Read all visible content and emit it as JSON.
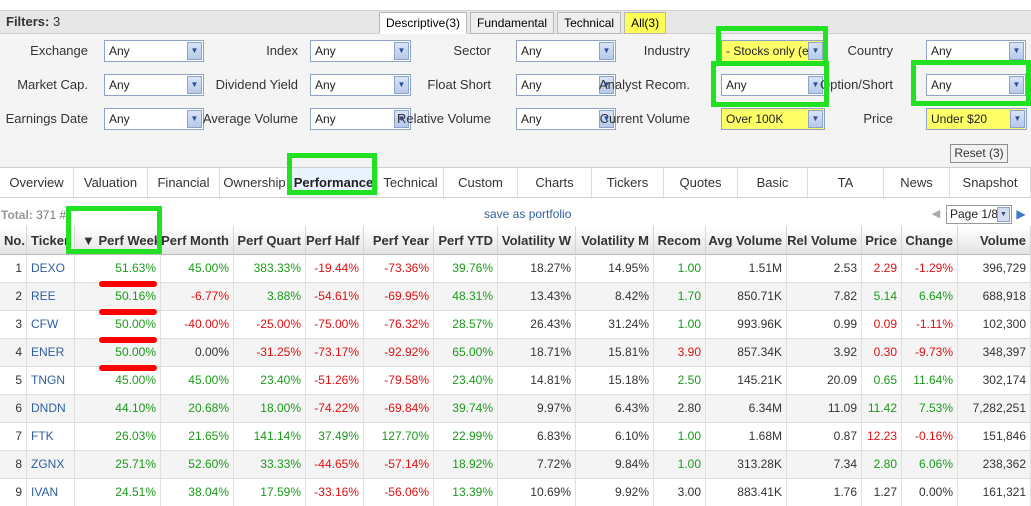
{
  "filters": {
    "label": "Filters:",
    "count": "3",
    "tabs": [
      "Descriptive(3)",
      "Fundamental",
      "Technical",
      "All(3)"
    ],
    "rows": [
      [
        {
          "label": "Exchange",
          "value": "Any"
        },
        {
          "label": "Index",
          "value": "Any"
        },
        {
          "label": "Sector",
          "value": "Any"
        },
        {
          "label": "Industry",
          "value": "- Stocks only (e"
        },
        {
          "label": "Country",
          "value": "Any"
        }
      ],
      [
        {
          "label": "Market Cap.",
          "value": "Any"
        },
        {
          "label": "Dividend Yield",
          "value": "Any"
        },
        {
          "label": "Float Short",
          "value": "Any"
        },
        {
          "label": "Analyst Recom.",
          "value": "Any"
        },
        {
          "label": "Option/Short",
          "value": "Any"
        }
      ],
      [
        {
          "label": "Earnings Date",
          "value": "Any"
        },
        {
          "label": "Average Volume",
          "value": "Any"
        },
        {
          "label": "Relative Volume",
          "value": "Any"
        },
        {
          "label": "Current Volume",
          "value": "Over 100K"
        },
        {
          "label": "Price",
          "value": "Under $20"
        }
      ]
    ],
    "reset_label": "Reset (3)"
  },
  "view_tabs": [
    "Overview",
    "Valuation",
    "Financial",
    "Ownership",
    "Performance",
    "Technical",
    "Custom",
    "Charts",
    "Tickers",
    "Quotes",
    "Basic",
    "TA",
    "News",
    "Snapshot"
  ],
  "total": {
    "label": "Total:",
    "value": "371 #"
  },
  "save_label": "save as portfolio",
  "page_label": "Page 1/8",
  "table": {
    "headers": [
      "No.",
      "Ticker",
      "Perf Week",
      "Perf Month",
      "Perf Quart",
      "Perf Half",
      "Perf Year",
      "Perf YTD",
      "Volatility W",
      "Volatility M",
      "Recom",
      "Avg Volume",
      "Rel Volume",
      "Price",
      "Change",
      "Volume"
    ],
    "sort_indicator": "▼",
    "rows": [
      [
        "1",
        "DEXO",
        "51.63%",
        "45.00%",
        "383.33%",
        "-19.44%",
        "-73.36%",
        "39.76%",
        "18.27%",
        "14.95%",
        "1.00",
        "1.51M",
        "2.53",
        "2.29",
        "-1.29%",
        "396,729"
      ],
      [
        "2",
        "REE",
        "50.16%",
        "-6.77%",
        "3.88%",
        "-54.61%",
        "-69.95%",
        "48.31%",
        "13.43%",
        "8.42%",
        "1.70",
        "850.71K",
        "7.82",
        "5.14",
        "6.64%",
        "688,918"
      ],
      [
        "3",
        "CFW",
        "50.00%",
        "-40.00%",
        "-25.00%",
        "-75.00%",
        "-76.32%",
        "28.57%",
        "26.43%",
        "31.24%",
        "1.00",
        "993.96K",
        "0.99",
        "0.09",
        "-1.11%",
        "102,300"
      ],
      [
        "4",
        "ENER",
        "50.00%",
        "0.00%",
        "-31.25%",
        "-73.17%",
        "-92.92%",
        "65.00%",
        "18.71%",
        "15.81%",
        "3.90",
        "857.34K",
        "3.92",
        "0.30",
        "-9.73%",
        "348,397"
      ],
      [
        "5",
        "TNGN",
        "45.00%",
        "45.00%",
        "23.40%",
        "-51.26%",
        "-79.58%",
        "23.40%",
        "14.81%",
        "15.18%",
        "2.50",
        "145.21K",
        "20.09",
        "0.65",
        "11.64%",
        "302,174"
      ],
      [
        "6",
        "DNDN",
        "44.10%",
        "20.68%",
        "18.00%",
        "-74.22%",
        "-69.84%",
        "39.74%",
        "9.97%",
        "6.43%",
        "2.80",
        "6.34M",
        "11.09",
        "11.42",
        "7.53%",
        "7,282,251"
      ],
      [
        "7",
        "FTK",
        "26.03%",
        "21.65%",
        "141.14%",
        "37.49%",
        "127.70%",
        "22.99%",
        "6.83%",
        "6.10%",
        "1.00",
        "1.68M",
        "0.87",
        "12.23",
        "-0.16%",
        "151,846"
      ],
      [
        "8",
        "ZGNX",
        "25.71%",
        "52.60%",
        "33.33%",
        "-44.65%",
        "-57.14%",
        "18.92%",
        "7.72%",
        "9.84%",
        "1.00",
        "313.28K",
        "7.34",
        "2.80",
        "6.06%",
        "238,362"
      ],
      [
        "9",
        "IVAN",
        "24.51%",
        "38.04%",
        "17.59%",
        "-33.16%",
        "-56.06%",
        "13.39%",
        "10.69%",
        "9.92%",
        "3.00",
        "883.41K",
        "1.76",
        "1.27",
        "0.00%",
        "161,321"
      ]
    ],
    "colors": {
      "positive": "#1a9a1a",
      "negative": "#e01010",
      "ticker": "#2f5f9e",
      "highlight": "#22e022"
    }
  }
}
